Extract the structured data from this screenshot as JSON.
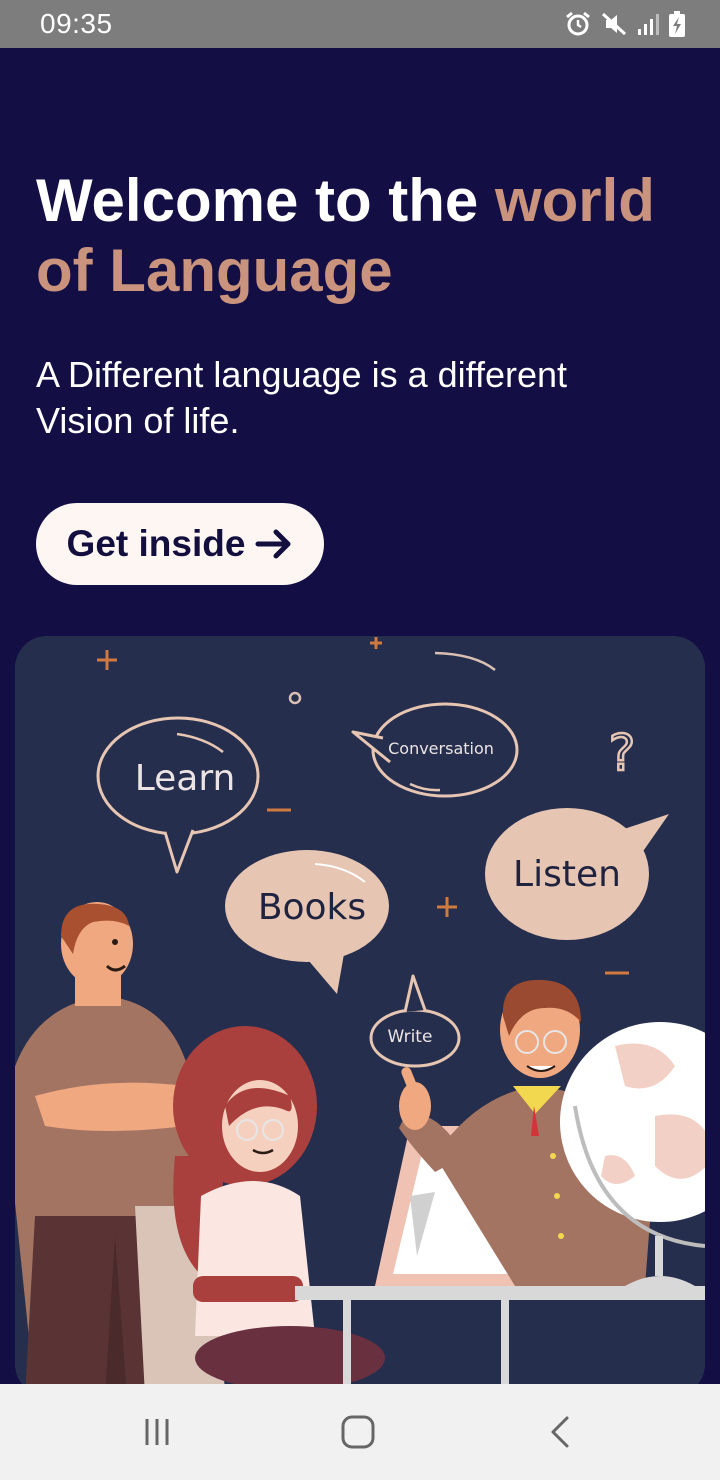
{
  "status_bar": {
    "time": "09:35",
    "icons": [
      "alarm-icon",
      "mute-icon",
      "signal-icon",
      "battery-icon"
    ]
  },
  "welcome": {
    "title_plain": "Welcome to the ",
    "title_accent": "world of Language",
    "subtitle": "A Different language is a different Vision of life.",
    "cta_label": "Get inside",
    "cta_icon": "arrow-right-icon"
  },
  "illustration": {
    "bubbles": {
      "learn": "Learn",
      "conversation": "Conversation",
      "books": "Books",
      "listen": "Listen",
      "write": "Write"
    },
    "question_mark": "?"
  },
  "navigation_bar": {
    "icons": [
      "recent-apps-icon",
      "home-icon",
      "back-icon"
    ]
  },
  "colors": {
    "background": "#130f45",
    "accent": "#c9937d",
    "button": "#fdf6f3",
    "card": "#262e4d",
    "status_bar": "#7d7d7d",
    "nav_bar": "#f1f1f1"
  }
}
